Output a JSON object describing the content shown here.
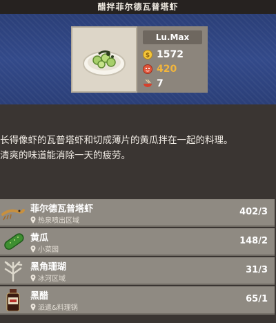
{
  "title": "醋拌菲尔德瓦普塔虾",
  "dish": {
    "image": "cucumber-shrimp-salad-icon",
    "level_label": "Lu.Max",
    "stats": [
      {
        "icon": "gold-coin-icon",
        "value": "1572",
        "color": "#ffffff"
      },
      {
        "icon": "face-energy-icon",
        "value": "420",
        "color": "#f2b53c"
      },
      {
        "icon": "bowl-chopsticks-icon",
        "value": "7",
        "color": "#ffffff"
      }
    ]
  },
  "description": [
    "长得像虾的瓦普塔虾和切成薄片的黄瓜拌在一起的料理。",
    "清爽的味道能消除一天的疲劳。"
  ],
  "ingredients": [
    {
      "name": "菲尔德瓦普塔虾",
      "location": "热泉喷出区域",
      "count": "402/3",
      "icon": "shrimp-icon"
    },
    {
      "name": "黄瓜",
      "location": "小菜园",
      "count": "148/2",
      "icon": "cucumber-icon"
    },
    {
      "name": "黑角珊瑚",
      "location": "冰河区域",
      "count": "31/3",
      "icon": "coral-icon"
    },
    {
      "name": "黑醋",
      "location": "派遣&料理锅",
      "count": "65/1",
      "icon": "vinegar-bottle-icon"
    }
  ],
  "colors": {
    "hero_bg": "#2f4684",
    "row_bg": "#8f8a82",
    "energy": "#f2b53c"
  }
}
